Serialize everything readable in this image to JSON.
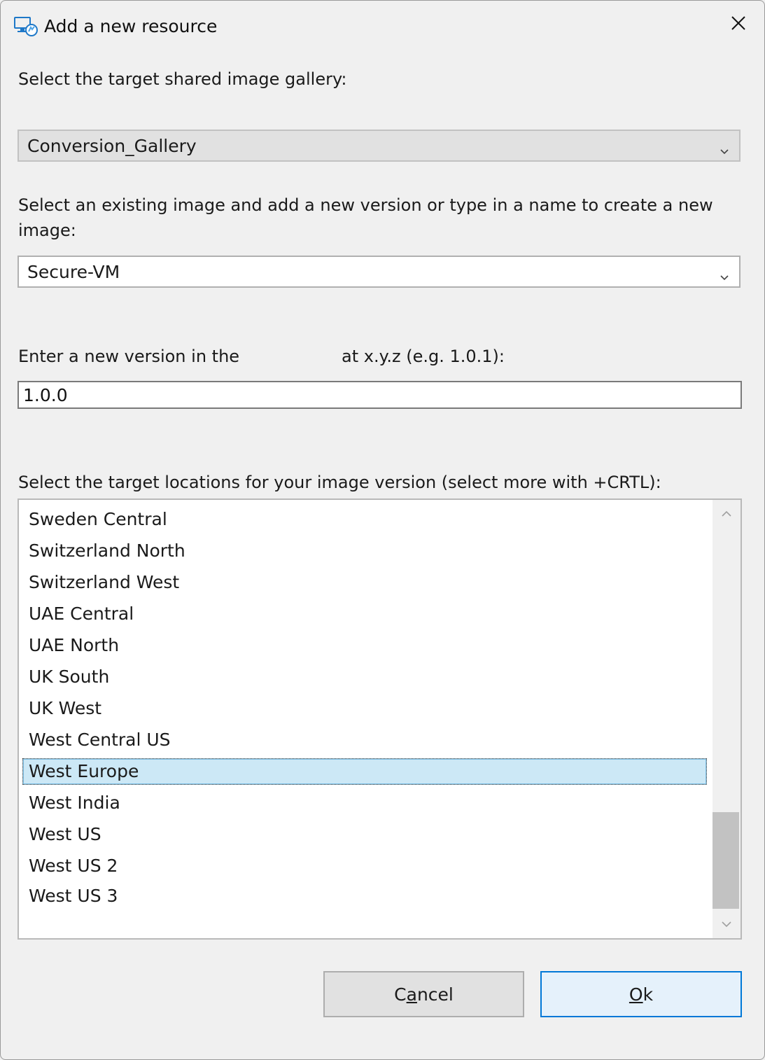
{
  "window": {
    "title": "Add a new resource"
  },
  "gallery": {
    "label": "Select the target shared image gallery:",
    "selected": "Conversion_Gallery"
  },
  "image": {
    "label": "Select an existing image and add a new version or type in a name to create a new image:",
    "selected": "Secure-VM"
  },
  "version": {
    "label_part1": "Enter a new version in the",
    "label_part2": "at x.y.z (e.g. 1.0.1):",
    "value": "1.0.0"
  },
  "locations": {
    "label": "Select the target locations for your image version (select more with +CRTL):",
    "items": [
      "Sweden Central",
      "Switzerland North",
      "Switzerland West",
      "UAE Central",
      "UAE North",
      "UK South",
      "UK West",
      "West Central US",
      "West Europe",
      "West India",
      "West US",
      "West US 2",
      "West US 3"
    ],
    "selected_index": 8
  },
  "buttons": {
    "cancel_mnemonic": "a",
    "cancel_prefix": "C",
    "cancel_suffix": "ncel",
    "ok_mnemonic": "O",
    "ok_suffix": "k"
  },
  "colors": {
    "selection_bg": "#cce8f6",
    "default_button_border": "#0078d7"
  },
  "icons": {
    "app": "azure-vm-icon",
    "close": "close-icon",
    "dropdown": "chevron-down-icon",
    "scroll_up": "chevron-up-icon",
    "scroll_down": "chevron-down-icon"
  }
}
